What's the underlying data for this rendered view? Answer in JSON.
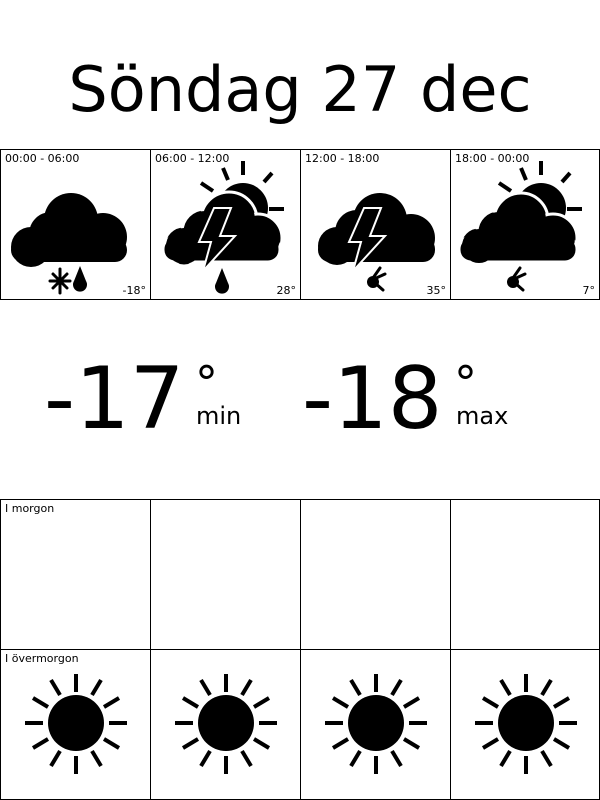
{
  "header": {
    "day_title": "Söndag 27 dec"
  },
  "periods": [
    {
      "time": "00:00 - 06:00",
      "temp": "-18°",
      "icon": "cloud-snow-rain-icon"
    },
    {
      "time": "06:00 - 12:00",
      "temp": "28°",
      "icon": "sun-cloud-thunder-rain-icon"
    },
    {
      "time": "12:00 - 18:00",
      "temp": "35°",
      "icon": "cloud-thunder-hail-icon"
    },
    {
      "time": "18:00 - 00:00",
      "temp": "7°",
      "icon": "sun-cloud-hail-icon"
    }
  ],
  "summary": {
    "min_value": "-17",
    "min_label": "min",
    "max_value": "-18",
    "max_label": "max",
    "degree_symbol": "°"
  },
  "forecast_rows": [
    {
      "label": "I morgon",
      "icons": [
        "",
        "",
        "",
        ""
      ]
    },
    {
      "label": "I övermorgon",
      "icons": [
        "sun-icon",
        "sun-icon",
        "sun-icon",
        "sun-icon"
      ]
    }
  ]
}
